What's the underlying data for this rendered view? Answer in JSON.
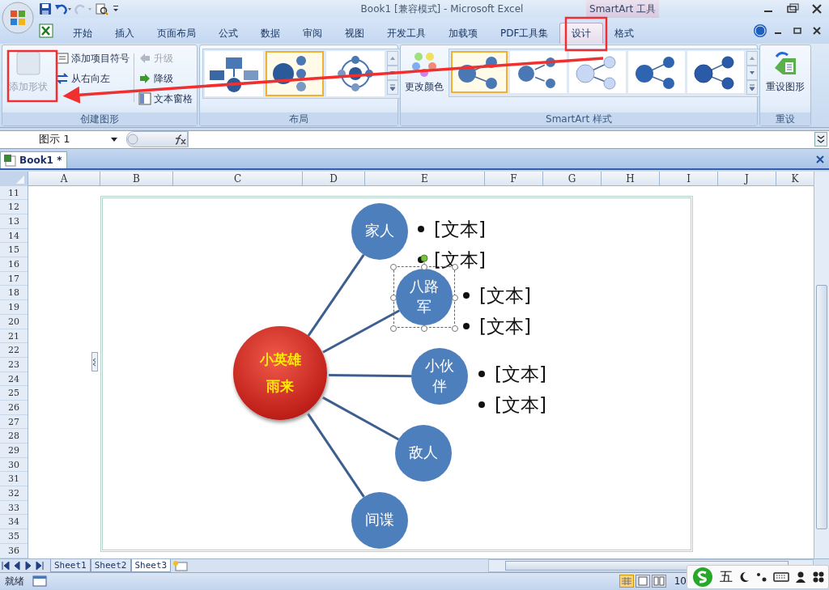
{
  "window": {
    "title": "Book1  [兼容模式] - Microsoft Excel",
    "context_label": "SmartArt 工具"
  },
  "tabs": [
    {
      "label": "开始",
      "selected": false
    },
    {
      "label": "插入",
      "selected": false
    },
    {
      "label": "页面布局",
      "selected": false
    },
    {
      "label": "公式",
      "selected": false
    },
    {
      "label": "数据",
      "selected": false
    },
    {
      "label": "审阅",
      "selected": false
    },
    {
      "label": "视图",
      "selected": false
    },
    {
      "label": "开发工具",
      "selected": false
    },
    {
      "label": "加载项",
      "selected": false
    },
    {
      "label": "PDF工具集",
      "selected": false
    },
    {
      "label": "设计",
      "selected": true
    },
    {
      "label": "格式",
      "selected": false
    }
  ],
  "ribbon": {
    "create_group": {
      "label": "创建图形",
      "add_shape": {
        "label": "添加形状",
        "disabled": true
      },
      "commands": [
        {
          "label": "添加项目符号",
          "disabled": false
        },
        {
          "label": "从右向左",
          "disabled": false
        }
      ],
      "level_commands": [
        {
          "label": "升级",
          "disabled": true
        },
        {
          "label": "降级",
          "disabled": false
        },
        {
          "label": "文本窗格",
          "disabled": false
        }
      ]
    },
    "layout_group": {
      "label": "布局",
      "layouts": [
        {
          "selected": false
        },
        {
          "selected": true
        },
        {
          "selected": false
        }
      ]
    },
    "styles_group": {
      "label": "SmartArt 样式",
      "change_colors": "更改颜色",
      "styles": [
        {
          "selected": true
        },
        {
          "selected": false
        },
        {
          "selected": false
        },
        {
          "selected": false
        },
        {
          "selected": false
        }
      ]
    },
    "reset_group": {
      "label": "重设",
      "reset_button": "重设图形"
    }
  },
  "name_box": "图示 1",
  "workbook_tab": "Book1 *",
  "columns": [
    "A",
    "B",
    "C",
    "D",
    "E",
    "F",
    "G",
    "H",
    "I",
    "J",
    "K"
  ],
  "rows": [
    "11",
    "12",
    "13",
    "14",
    "15",
    "16",
    "17",
    "18",
    "19",
    "20",
    "21",
    "22",
    "23",
    "24",
    "25",
    "26",
    "27",
    "28",
    "29",
    "30",
    "31",
    "32",
    "33",
    "34",
    "35",
    "36"
  ],
  "smartart": {
    "center": [
      "小英雄",
      "雨来"
    ],
    "nodes": [
      {
        "text": "家人",
        "selected": false,
        "bullets": [
          "[文本]",
          "[文本]"
        ]
      },
      {
        "text": "八路军",
        "selected": true,
        "bullets": [
          "[文本]",
          "[文本]"
        ]
      },
      {
        "text": "小伙伴",
        "selected": false,
        "bullets": [
          "[文本]",
          "[文本]"
        ]
      },
      {
        "text": "敌人",
        "selected": false
      },
      {
        "text": "间谍",
        "selected": false
      }
    ]
  },
  "sheet_tabs": [
    {
      "label": "Sheet1",
      "selected": false
    },
    {
      "label": "Sheet2",
      "selected": false
    },
    {
      "label": "Sheet3",
      "selected": true
    }
  ],
  "status_bar": {
    "status": "就绪",
    "zoom": "10"
  },
  "ime": {
    "mode": "五"
  }
}
